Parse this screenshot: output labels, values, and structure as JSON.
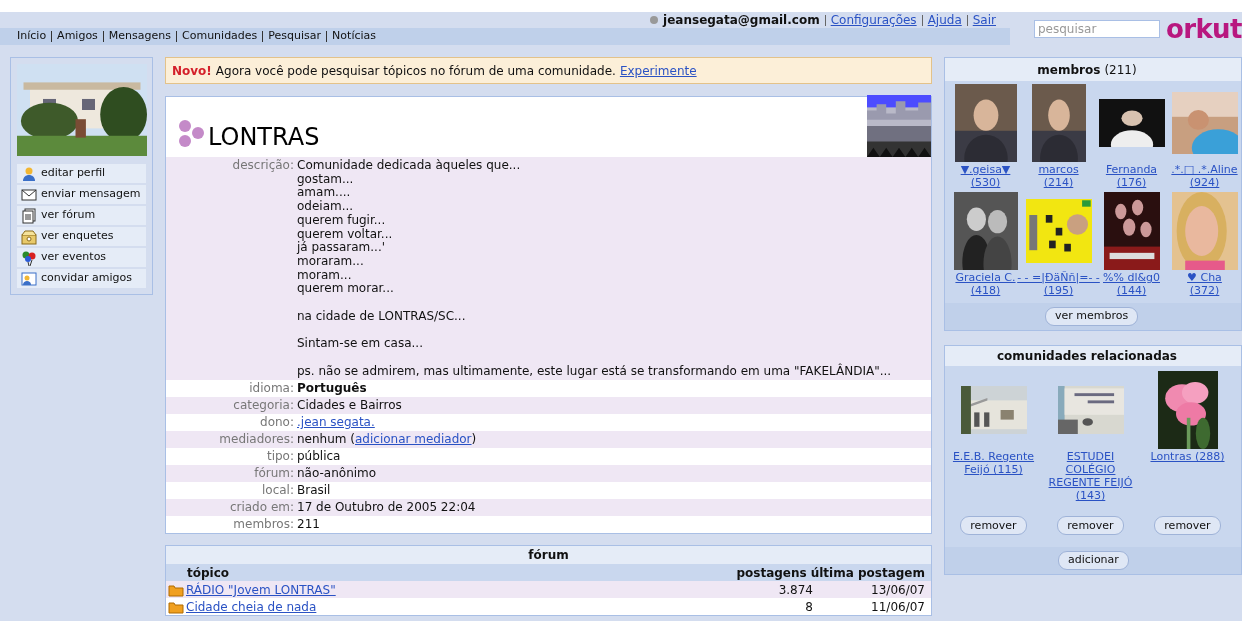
{
  "header": {
    "user": "jeansegata@gmail.com",
    "links": [
      "Configurações",
      "Ajuda",
      "Sair"
    ],
    "nav": [
      "Início",
      "Amigos",
      "Mensagens",
      "Comunidades",
      "Pesquisar",
      "Notícias"
    ],
    "search": {
      "placeholder": "pesquisar"
    },
    "logo": "orkut"
  },
  "sidebar": {
    "items": [
      {
        "label": "editar perfil"
      },
      {
        "label": "enviar mensagem"
      },
      {
        "label": "ver fórum"
      },
      {
        "label": "ver enquetes"
      },
      {
        "label": "ver eventos"
      },
      {
        "label": "convidar amigos"
      }
    ]
  },
  "notice": {
    "badge": "Novo!",
    "text": "Agora você pode pesquisar tópicos no fórum de uma comunidade.",
    "link": "Experimente"
  },
  "community": {
    "name": "LONTRAS",
    "details": [
      {
        "label": "descrição:",
        "kind": "lines",
        "paragraphs": [
          [
            "Comunidade dedicada àqueles que...",
            "gostam...",
            "amam....",
            "odeiam...",
            "querem fugir...",
            "querem voltar...",
            "já passaram...'",
            "moraram...",
            "moram...",
            "querem morar..."
          ],
          [
            "na cidade de LONTRAS/SC..."
          ],
          [
            "Sintam-se em casa..."
          ],
          [
            "ps. não se admirem, mas ultimamente, este lugar está se transformando em uma \"FAKELÂNDIA\"..."
          ]
        ]
      },
      {
        "label": "idioma:",
        "kind": "bold",
        "value": "Português"
      },
      {
        "label": "categoria:",
        "kind": "text",
        "value": "Cidades e Bairros"
      },
      {
        "label": "dono:",
        "kind": "link",
        "value": ".jean segata."
      },
      {
        "label": "mediadores:",
        "kind": "parts",
        "parts": [
          {
            "text": "nenhum (",
            "kind": "text"
          },
          {
            "text": "adicionar mediador",
            "kind": "link"
          },
          {
            "text": ")",
            "kind": "text"
          }
        ]
      },
      {
        "label": "tipo:",
        "kind": "text",
        "value": "pública"
      },
      {
        "label": "fórum:",
        "kind": "text",
        "value": "não-anônimo"
      },
      {
        "label": "local:",
        "kind": "text",
        "value": "Brasil"
      },
      {
        "label": "criado em:",
        "kind": "text",
        "value": "17 de Outubro de 2005 22:04"
      },
      {
        "label": "membros:",
        "kind": "text",
        "value": "211"
      }
    ]
  },
  "forum": {
    "title": "fórum",
    "columns": [
      "tópico",
      "postagens",
      "última postagem"
    ],
    "rows": [
      {
        "topic": "RÁDIO \"Jovem LONTRAS\"",
        "posts": "3.874",
        "last": "13/06/07"
      },
      {
        "topic": "Cidade cheia de nada",
        "posts": "8",
        "last": "11/06/07"
      }
    ]
  },
  "members": {
    "title": "membros",
    "count": "(211)",
    "items": [
      {
        "name": "▼.geisa▼",
        "count": "(530)"
      },
      {
        "name": "marcos",
        "count": "(214)"
      },
      {
        "name": "Fernanda",
        "count": "(176)"
      },
      {
        "name": ".*.□ .*.Aline",
        "count": "(924)"
      },
      {
        "name": "Graciela C.",
        "count": "(418)"
      },
      {
        "name": "- - =|ÐäÑñ|=- -",
        "count": "(195)"
      },
      {
        "name": "%% dl&g0",
        "count": "(144)"
      },
      {
        "name": "♥ Cha",
        "count": "(372)"
      }
    ],
    "button": "ver membros"
  },
  "related": {
    "title": "comunidades relacionadas",
    "items": [
      {
        "name": "E.E.B. Regente Feijó",
        "count": "(115)",
        "button": "remover"
      },
      {
        "name": "ESTUDEI COLÉGIO REGENTE FEIJÓ",
        "count": "(143)",
        "button": "remover"
      },
      {
        "name": "Lontras",
        "count": "(288)",
        "button": "remover"
      }
    ],
    "button": "adicionar"
  }
}
